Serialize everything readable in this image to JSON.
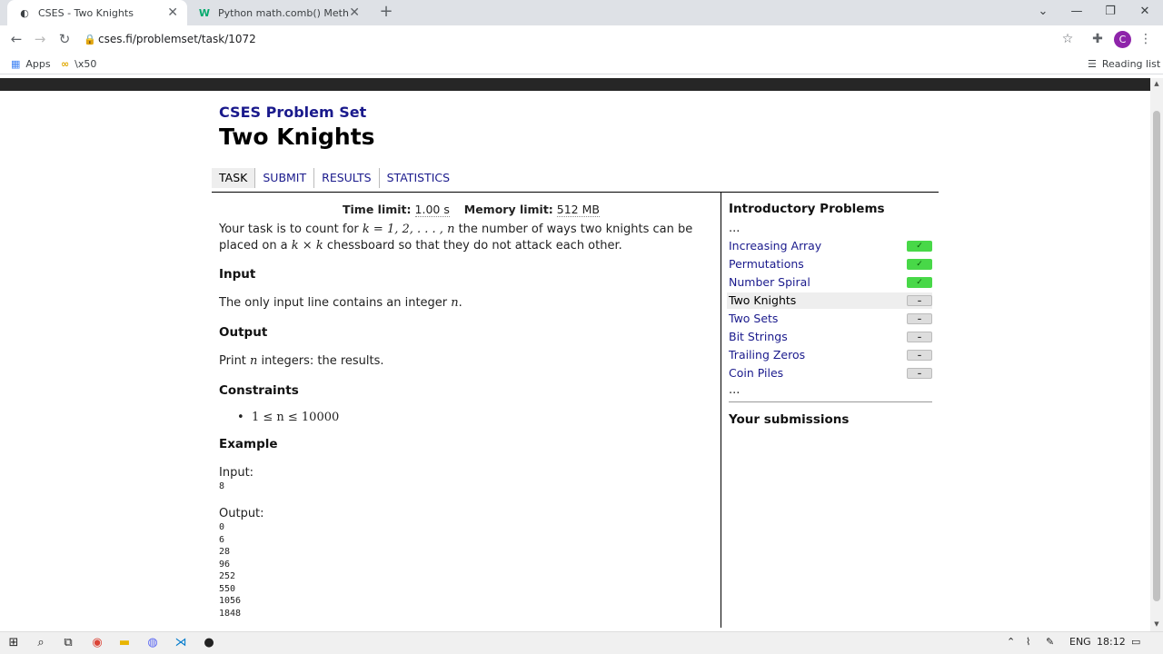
{
  "browser": {
    "tabs": [
      {
        "title": "CSES - Two Knights",
        "favicon": "cses-favicon"
      },
      {
        "title": "Python math.comb() Method",
        "favicon": "w3schools-favicon"
      }
    ],
    "url": "cses.fi/problemset/task/1072",
    "bookmarks": [
      {
        "label": "Apps",
        "icon": "apps-grid-icon"
      },
      {
        "label": "\\x50",
        "icon": "bookmark-icon"
      }
    ],
    "reading_list": "Reading list",
    "avatar_letter": "C"
  },
  "page": {
    "site_title": "CSES Problem Set",
    "title": "Two Knights",
    "nav": [
      "TASK",
      "SUBMIT",
      "RESULTS",
      "STATISTICS"
    ],
    "time_limit_label": "Time limit:",
    "time_limit_value": "1.00 s",
    "memory_limit_label": "Memory limit:",
    "memory_limit_value": "512 MB",
    "statement": {
      "line1_a": "Your task is to count for ",
      "line1_m": "k = 1, 2, . . . , n",
      "line1_b": " the number of ways two knights can be",
      "line2_a": "placed on a ",
      "line2_m": "k × k",
      "line2_b": " chessboard so that they do not attack each other."
    },
    "input_heading": "Input",
    "input_text_a": "The only input line contains an integer ",
    "input_text_m": "n",
    "input_text_b": ".",
    "output_heading": "Output",
    "output_text_a": "Print ",
    "output_text_m": "n",
    "output_text_b": " integers: the results.",
    "constraints_heading": "Constraints",
    "constraint": "1 ≤ n ≤ 10000",
    "example_heading": "Example",
    "example_input_label": "Input:",
    "example_input": [
      "8"
    ],
    "example_output_label": "Output:",
    "example_output": [
      "0",
      "6",
      "28",
      "96",
      "252",
      "550",
      "1056",
      "1848"
    ]
  },
  "sidebar": {
    "title": "Introductory Problems",
    "ellipsis": "...",
    "items": [
      {
        "label": "Increasing Array",
        "status": "✓",
        "state": "done"
      },
      {
        "label": "Permutations",
        "status": "✓",
        "state": "done"
      },
      {
        "label": "Number Spiral",
        "status": "✓",
        "state": "done"
      },
      {
        "label": "Two Knights",
        "status": "–",
        "state": "current"
      },
      {
        "label": "Two Sets",
        "status": "–",
        "state": "todo"
      },
      {
        "label": "Bit Strings",
        "status": "–",
        "state": "todo"
      },
      {
        "label": "Trailing Zeros",
        "status": "–",
        "state": "todo"
      },
      {
        "label": "Coin Piles",
        "status": "–",
        "state": "todo"
      }
    ],
    "submissions_title": "Your submissions"
  },
  "taskbar": {
    "language": "ENG",
    "time": "18:12"
  }
}
